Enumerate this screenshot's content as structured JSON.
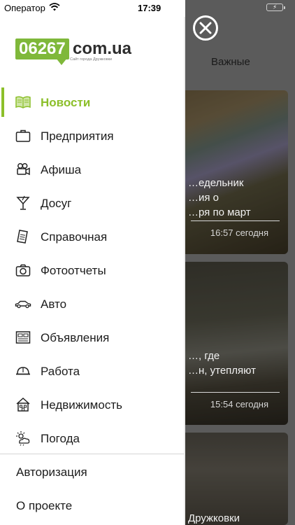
{
  "status_bar": {
    "carrier": "Оператор",
    "time": "17:39",
    "battery_color": "#4cd964"
  },
  "logo": {
    "number": "06267",
    "domain": "com.ua",
    "slogan": "Сайт города Дружковки",
    "brand_color": "#7fb83a"
  },
  "menu": {
    "accent_color": "#8cbf2a",
    "items": [
      {
        "label": "Новости",
        "icon": "newspaper-icon",
        "active": true
      },
      {
        "label": "Предприятия",
        "icon": "briefcase-icon"
      },
      {
        "label": "Афиша",
        "icon": "film-camera-icon"
      },
      {
        "label": "Досуг",
        "icon": "cocktail-icon"
      },
      {
        "label": "Справочная",
        "icon": "document-icon"
      },
      {
        "label": "Фотоотчеты",
        "icon": "camera-icon"
      },
      {
        "label": "Авто",
        "icon": "car-icon"
      },
      {
        "label": "Объявления",
        "icon": "bulletin-board-icon"
      },
      {
        "label": "Работа",
        "icon": "hard-hat-icon"
      },
      {
        "label": "Недвижимость",
        "icon": "house-icon"
      },
      {
        "label": "Погода",
        "icon": "weather-icon"
      }
    ],
    "bottom": [
      {
        "label": "Авторизация"
      },
      {
        "label": "О проекте"
      }
    ]
  },
  "background_page": {
    "tab_label": "Важные",
    "cards": [
      {
        "title": "…едельник\n…ия о\n…ря по март",
        "time": "16:57 сегодня"
      },
      {
        "title": "…, где\n…н, утепляют",
        "time": "15:54 сегодня"
      },
      {
        "title": "Дружковки",
        "time": ""
      }
    ]
  }
}
